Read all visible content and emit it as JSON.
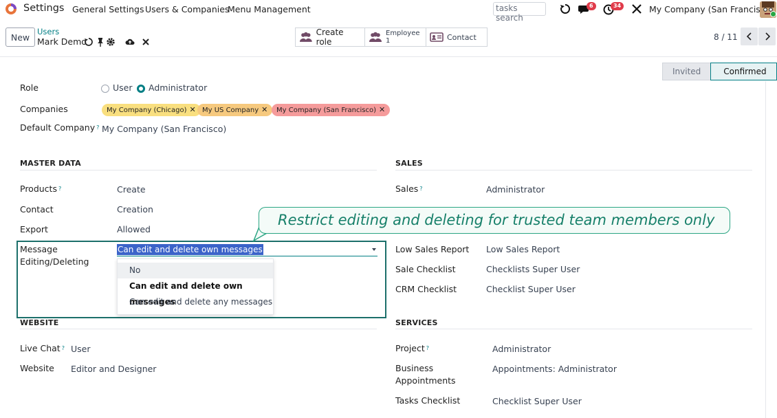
{
  "navbar": {
    "app_name": "Settings",
    "menu": [
      "General Settings",
      "Users & Companies",
      "Menu Management"
    ],
    "search_placeholder": "tasks search",
    "messages_badge": "6",
    "activities_badge": "34",
    "company": "My Company (San Francisco)"
  },
  "control": {
    "new_label": "New",
    "breadcrumb": "Users",
    "record_name": "Mark Demo",
    "smart_buttons": {
      "create_role": "Create role",
      "employee_label": "Employee",
      "employee_count": "1",
      "contact": "Contact"
    },
    "pager": "8 / 11"
  },
  "status": {
    "invited": "Invited",
    "confirmed": "Confirmed"
  },
  "form": {
    "role_label": "Role",
    "role_user": "User",
    "role_admin": "Administrator",
    "companies_label": "Companies",
    "companies": [
      {
        "name": "My Company (Chicago)",
        "color": "#f9df7f"
      },
      {
        "name": "My US Company",
        "color": "#f6c97e"
      },
      {
        "name": "My Company (San Francisco)",
        "color": "#f59b9b"
      }
    ],
    "default_company_label": "Default Company",
    "default_company": "My Company (San Francisco)"
  },
  "master_data": {
    "title": "MASTER DATA",
    "rows": [
      {
        "label": "Products",
        "value": "Create"
      },
      {
        "label": "Contact",
        "value": "Creation"
      },
      {
        "label": "Export",
        "value": "Allowed"
      }
    ],
    "message_label_1": "Message",
    "message_label_2": "Editing/Deleting",
    "message_value": "Can edit and delete own messages",
    "dropdown": [
      "No",
      "Can edit and delete own messages",
      "Can edit and delete any messages"
    ]
  },
  "sales": {
    "title": "SALES",
    "rows": [
      {
        "label": "Sales",
        "value": "Administrator"
      },
      {
        "label": "Low Sales Report",
        "value": "Low Sales Report"
      },
      {
        "label": "Sale Checklist",
        "value": "Checklists Super User"
      },
      {
        "label": "CRM Checklist",
        "value": "Checklist Super User"
      }
    ]
  },
  "website": {
    "title": "WEBSITE",
    "rows": [
      {
        "label": "Live Chat",
        "value": "User"
      },
      {
        "label": "Website",
        "value": "Editor and Designer"
      }
    ]
  },
  "services": {
    "title": "SERVICES",
    "rows": [
      {
        "label": "Project",
        "value": "Administrator"
      },
      {
        "label_1": "Business",
        "label_2": "Appointments",
        "value": "Appointments: Administrator"
      },
      {
        "label": "Tasks Checklist",
        "value": "Checklist Super User"
      }
    ]
  },
  "callout": {
    "text": "Restrict editing and deleting for trusted team members only"
  },
  "colors": {
    "accent": "#017e84",
    "frame": "#1b6f6a",
    "callout_border": "#2aa583",
    "selection": "#3b63c9"
  }
}
